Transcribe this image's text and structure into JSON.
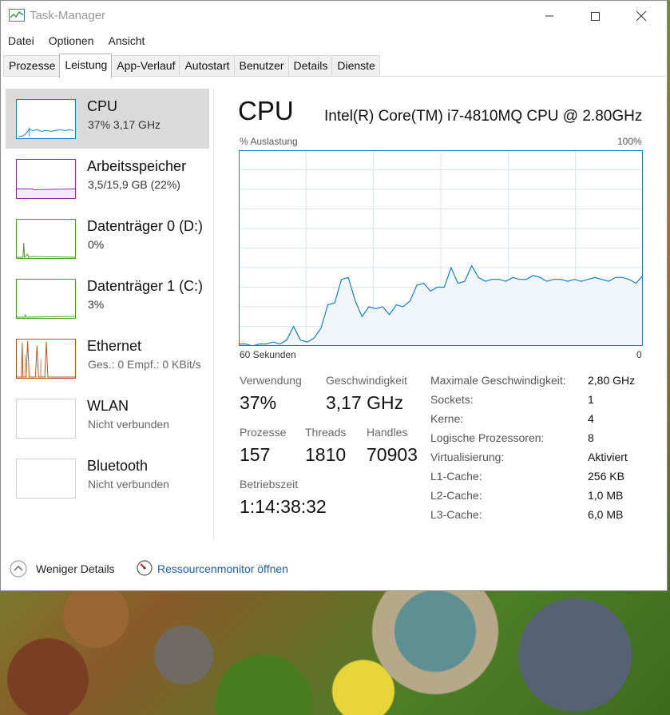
{
  "window": {
    "title": "Task-Manager"
  },
  "menu": [
    "Datei",
    "Optionen",
    "Ansicht"
  ],
  "tabs": [
    {
      "label": "Prozesse",
      "active": false
    },
    {
      "label": "Leistung",
      "active": true
    },
    {
      "label": "App-Verlauf",
      "active": false
    },
    {
      "label": "Autostart",
      "active": false
    },
    {
      "label": "Benutzer",
      "active": false
    },
    {
      "label": "Details",
      "active": false
    },
    {
      "label": "Dienste",
      "active": false
    }
  ],
  "sidebar": [
    {
      "name": "CPU",
      "sub": "37% 3,17 GHz",
      "color": "#1a7fc1",
      "selected": true,
      "icon": "cpu-graph-icon"
    },
    {
      "name": "Arbeitsspeicher",
      "sub": "3,5/15,9 GB (22%)",
      "color": "#8b2ca8",
      "selected": false,
      "icon": "memory-graph-icon"
    },
    {
      "name": "Datenträger 0 (D:)",
      "sub": "0%",
      "color": "#4d9a1c",
      "selected": false,
      "icon": "disk-graph-icon"
    },
    {
      "name": "Datenträger 1 (C:)",
      "sub": "3%",
      "color": "#4d9a1c",
      "selected": false,
      "icon": "disk-graph-icon"
    },
    {
      "name": "Ethernet",
      "sub": "Ges.: 0 Empf.: 0 KBit/s",
      "color": "#b6531a",
      "selected": false,
      "icon": "network-graph-icon"
    },
    {
      "name": "WLAN",
      "sub": "Nicht verbunden",
      "color": "#c8c8c8",
      "selected": false,
      "icon": "wlan-graph-icon"
    },
    {
      "name": "Bluetooth",
      "sub": "Nicht verbunden",
      "color": "#c8c8c8",
      "selected": false,
      "icon": "bluetooth-graph-icon"
    }
  ],
  "main": {
    "title": "CPU",
    "model": "Intel(R) Core(TM) i7-4810MQ CPU @ 2.80GHz",
    "util_label": "% Auslastung",
    "util_max": "100%",
    "time_label": "60 Sekunden",
    "time_zero": "0"
  },
  "stats": {
    "verwendung": {
      "label": "Verwendung",
      "value": "37%"
    },
    "geschwindigkeit": {
      "label": "Geschwindigkeit",
      "value": "3,17 GHz"
    },
    "prozesse": {
      "label": "Prozesse",
      "value": "157"
    },
    "threads": {
      "label": "Threads",
      "value": "1810"
    },
    "handles": {
      "label": "Handles",
      "value": "70903"
    },
    "betriebszeit": {
      "label": "Betriebszeit",
      "value": "1:14:38:32"
    }
  },
  "specs": [
    {
      "label": "Maximale Geschwindigkeit:",
      "value": "2,80 GHz"
    },
    {
      "label": "Sockets:",
      "value": "1"
    },
    {
      "label": "Kerne:",
      "value": "4"
    },
    {
      "label": "Logische Prozessoren:",
      "value": "8"
    },
    {
      "label": "Virtualisierung:",
      "value": "Aktiviert"
    },
    {
      "label": "L1-Cache:",
      "value": "256 KB"
    },
    {
      "label": "L2-Cache:",
      "value": "1,0 MB"
    },
    {
      "label": "L3-Cache:",
      "value": "6,0 MB"
    }
  ],
  "footer": {
    "less_details": "Weniger Details",
    "resource_monitor": "Ressourcenmonitor öffnen"
  },
  "colors": {
    "cpu_line": "#1a7fc1",
    "cpu_fill": "#f1f6fb",
    "grid": "#d8e6f2"
  },
  "cpu_history": [
    1,
    1,
    0,
    1,
    1,
    2,
    1,
    3,
    10,
    3,
    2,
    4,
    9,
    21,
    22,
    34,
    35,
    23,
    15,
    20,
    19,
    20,
    16,
    21,
    20,
    23,
    31,
    32,
    28,
    30,
    30,
    40,
    32,
    33,
    41,
    35,
    33,
    34,
    34,
    33,
    35,
    34,
    34,
    36,
    35,
    33,
    34,
    34,
    33,
    34,
    33,
    34,
    35,
    34,
    33,
    35,
    35,
    34,
    32,
    36
  ]
}
